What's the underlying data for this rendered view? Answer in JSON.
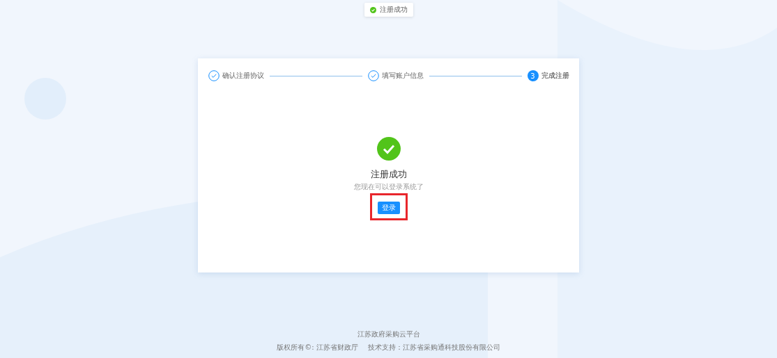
{
  "toast": {
    "text": "注册成功"
  },
  "steps": [
    {
      "label": "确认注册协议",
      "kind": "done"
    },
    {
      "label": "填写账户信息",
      "kind": "done"
    },
    {
      "label": "完成注册",
      "kind": "current",
      "number": "3"
    }
  ],
  "result": {
    "title": "注册成功",
    "subtitle": "您现在可以登录系统了",
    "button": "登录",
    "highlighted": true
  },
  "footer": {
    "platform": "江苏政府采购云平台",
    "copyright": "版权所有©: 江苏省财政厅",
    "support": "技术支持：江苏省采购通科技股份有限公司"
  }
}
